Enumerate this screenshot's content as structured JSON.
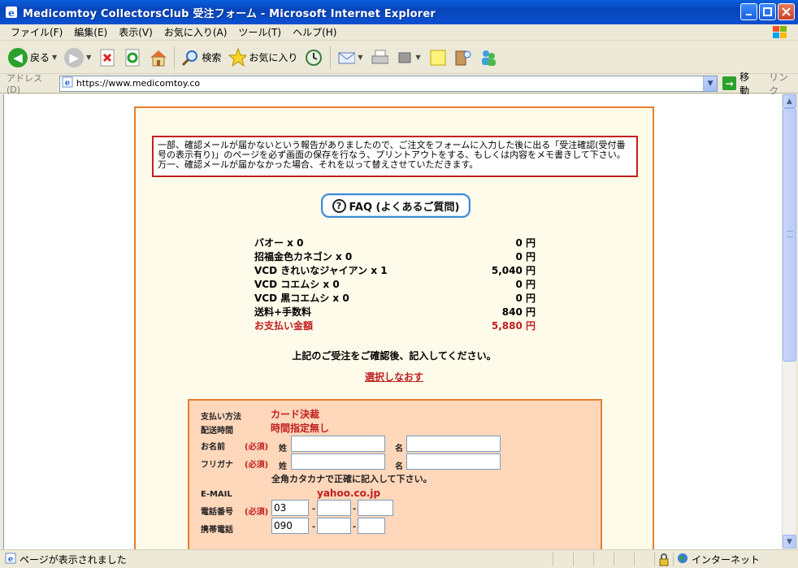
{
  "window": {
    "title": "Medicomtoy CollectorsClub 受注フォーム - Microsoft Internet Explorer"
  },
  "menu": [
    "ファイル(F)",
    "編集(E)",
    "表示(V)",
    "お気に入り(A)",
    "ツール(T)",
    "ヘルプ(H)"
  ],
  "toolbar": {
    "back_label": "戻る",
    "search_label": "検索",
    "favorites_label": "お気に入り"
  },
  "address": {
    "label": "アドレス(D)",
    "url": "https://www.medicomtoy.co",
    "go_label": "移動",
    "links_label": "リンク"
  },
  "page": {
    "notice": "一部、確認メールが届かないという報告がありましたので、ご注文をフォームに入力した後に出る「受注確認(受付番号の表示有り)」のページを必ず画面の保存を行なう、プリントアウトをする、もしくは内容をメモ書きして下さい。万一、確認メールが届かなかった場合、それを以って替えさせていただきます。",
    "faq_label": "FAQ (よくあるご質問)",
    "order_items": [
      {
        "name": "バオー x 0",
        "price": "0 円"
      },
      {
        "name": "招福金色カネゴン x 0",
        "price": "0 円"
      },
      {
        "name": "VCD きれいなジャイアン x 1",
        "price": "5,040 円"
      },
      {
        "name": "VCD コエムシ x 0",
        "price": "0 円"
      },
      {
        "name": "VCD 黒コエムシ x 0",
        "price": "0 円"
      },
      {
        "name": "送料+手数料",
        "price": "840 円"
      }
    ],
    "total": {
      "name": "お支払い金額",
      "price": "5,880 円"
    },
    "confirm_text": "上記のご受注をご確認後、記入してください。",
    "reselect_link": "選択しなおす"
  },
  "form": {
    "payment_label": "支払い方法",
    "payment_value": "カード決裁",
    "delivery_label": "配送時間",
    "delivery_value": "時間指定無し",
    "name_label": "お名前",
    "required": "(必須)",
    "last_name": "姓",
    "first_name": "名",
    "kana_label": "フリガナ",
    "kana_note": "全角カタカナで正確に記入して下さい。",
    "email_label": "E-MAIL",
    "email_value": "yahoo.co.jp",
    "phone_label": "電話番号",
    "phone_prefix": "03",
    "mobile_label": "携帯電話",
    "mobile_prefix": "090",
    "dash": "-"
  },
  "status": {
    "text": "ページが表示されました",
    "zone": "インターネット"
  }
}
